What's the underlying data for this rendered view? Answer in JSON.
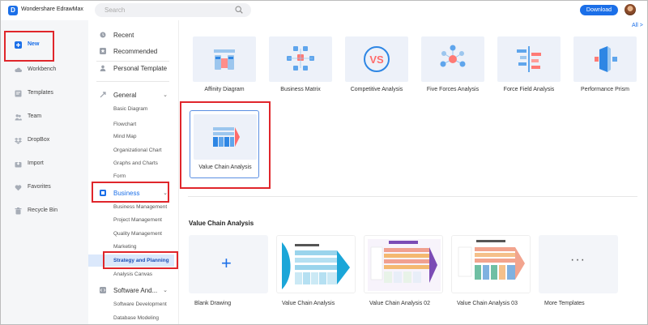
{
  "app": {
    "title": "Wondershare EdrawMax",
    "logo_glyph": "D"
  },
  "search": {
    "placeholder": "Search"
  },
  "header": {
    "download_label": "Download"
  },
  "left_nav": [
    {
      "label": "New",
      "icon": "plus-square-icon",
      "active": true
    },
    {
      "label": "Workbench",
      "icon": "cloud-icon"
    },
    {
      "label": "Templates",
      "icon": "template-icon"
    },
    {
      "label": "Team",
      "icon": "team-icon"
    },
    {
      "label": "DropBox",
      "icon": "dropbox-icon"
    },
    {
      "label": "Import",
      "icon": "import-icon"
    },
    {
      "label": "Favorites",
      "icon": "heart-icon"
    },
    {
      "label": "Recycle Bin",
      "icon": "trash-icon"
    }
  ],
  "categories": {
    "quick": [
      {
        "label": "Recent",
        "icon": "clock-icon"
      },
      {
        "label": "Recommended",
        "icon": "star-icon"
      },
      {
        "label": "Personal Template",
        "icon": "user-icon"
      }
    ],
    "general": {
      "label": "General",
      "items": [
        "Basic Diagram",
        "Flowchart",
        "Mind Map",
        "Organizational Chart",
        "Graphs and Charts",
        "Form"
      ]
    },
    "business": {
      "label": "Business",
      "items": [
        "Business Management",
        "Project Management",
        "Quality Management",
        "Marketing",
        "Strategy and Planning",
        "Analysis Canvas"
      ],
      "selected": "Strategy and Planning"
    },
    "software": {
      "label": "Software And...",
      "items": [
        "Software Development",
        "Database Modeling"
      ]
    }
  },
  "content": {
    "all_label": "All >",
    "templates": [
      {
        "label": "Affinity Diagram"
      },
      {
        "label": "Business Matrix"
      },
      {
        "label": "Competitive Analysis",
        "thumb_text": "VS"
      },
      {
        "label": "Five Forces Analysis"
      },
      {
        "label": "Force Field Analysis"
      },
      {
        "label": "Performance Prism"
      },
      {
        "label": "Value Chain Analysis",
        "selected": true
      }
    ],
    "section_title": "Value Chain Analysis",
    "cards": [
      {
        "label": "Blank Drawing",
        "glyph": "+"
      },
      {
        "label": "Value Chain Analysis"
      },
      {
        "label": "Value Chain Analysis 02"
      },
      {
        "label": "Value Chain Analysis 03"
      },
      {
        "label": "More Templates",
        "glyph": "···"
      }
    ]
  },
  "colors": {
    "accent": "#1b6fe8",
    "highlight": "#e0262b",
    "selected_bg": "#dbe8fb"
  }
}
